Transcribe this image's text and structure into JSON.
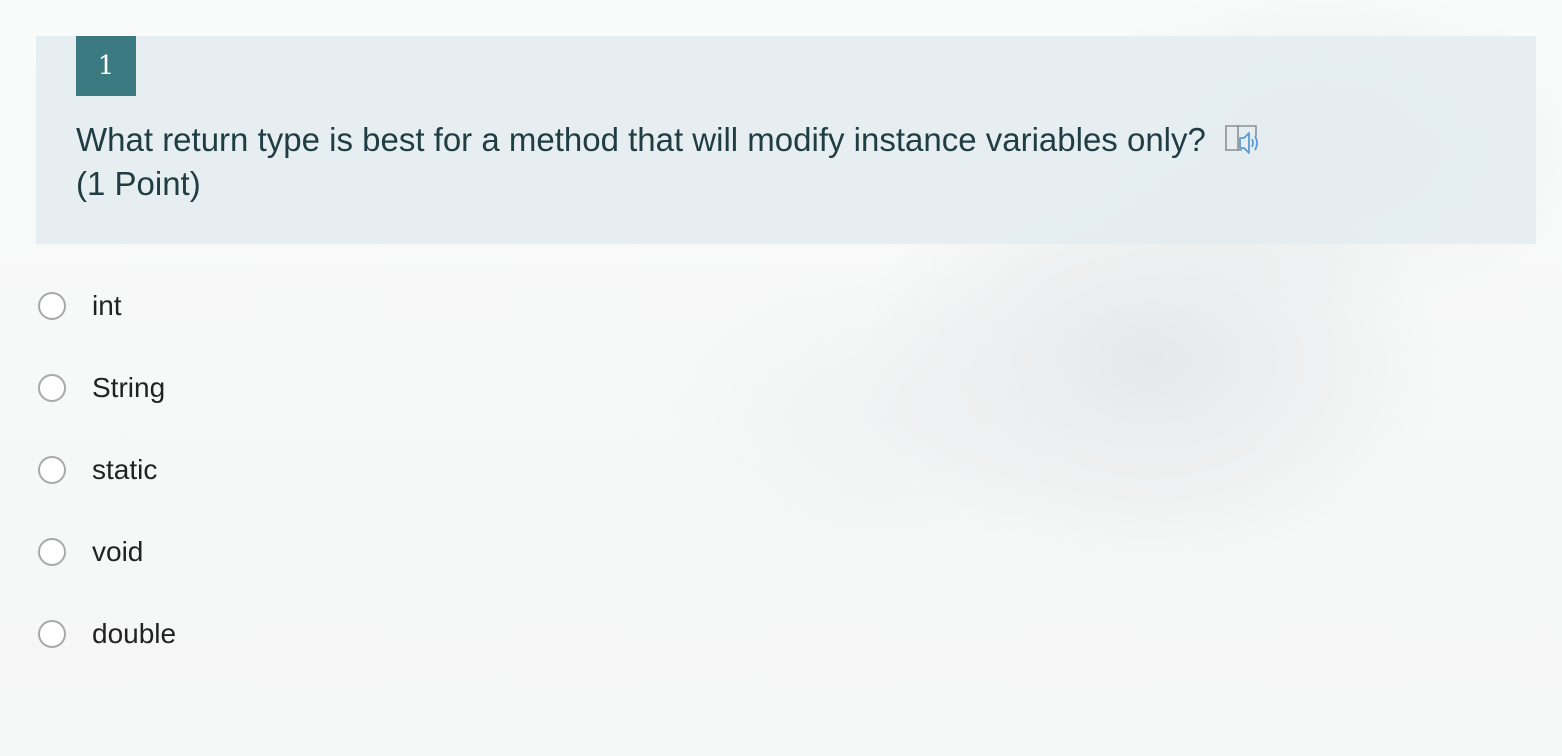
{
  "question": {
    "number": "1",
    "text": "What return type is best for a method that will modify instance variables only?",
    "points": "(1 Point)",
    "immersive_reader_icon": "immersive-reader-icon"
  },
  "options": [
    {
      "label": "int",
      "selected": false
    },
    {
      "label": "String",
      "selected": false
    },
    {
      "label": "static",
      "selected": false
    },
    {
      "label": "void",
      "selected": false
    },
    {
      "label": "double",
      "selected": false
    }
  ],
  "colors": {
    "number_badge": "#3a7a80",
    "header_background": "#e4edf0",
    "question_text": "#1f3d42",
    "reader_icon": "#5b9bd5"
  }
}
